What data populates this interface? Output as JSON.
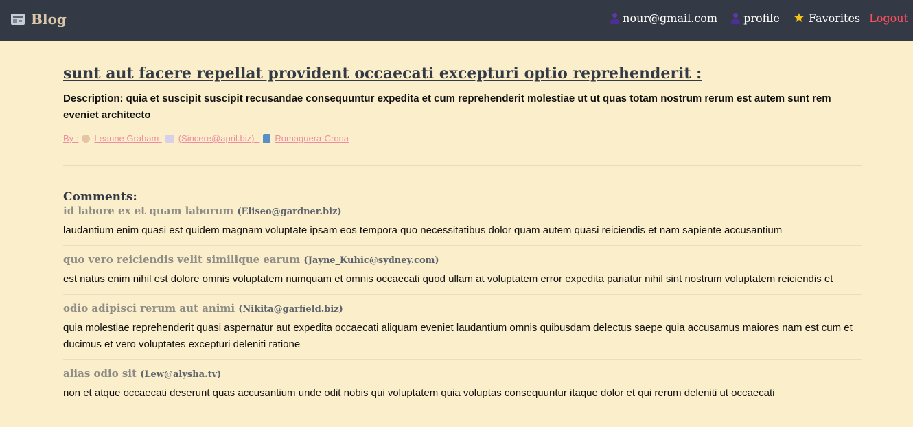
{
  "navbar": {
    "brand": "Blog",
    "user_email": "nour@gmail.com",
    "profile_label": "profile",
    "favorites_label": "Favorites",
    "logout_label": "Logout"
  },
  "post": {
    "title": "sunt aut facere repellat provident occaecati excepturi optio reprehenderit :",
    "description": "Description: quia et suscipit suscipit recusandae consequuntur expedita et cum reprehenderit molestiae ut ut quas totam nostrum rerum est autem sunt rem eveniet architecto",
    "byline": {
      "prefix": "By :",
      "author": "Leanne Graham-",
      "email": "(Sincere@april.biz) -",
      "company": "Romaguera-Crona"
    }
  },
  "comments_heading": "Comments:",
  "comments": [
    {
      "name": "id labore ex et quam laborum",
      "email": "(Eliseo@gardner.biz)",
      "body": "laudantium enim quasi est quidem magnam voluptate ipsam eos tempora quo necessitatibus dolor quam autem quasi reiciendis et nam sapiente accusantium"
    },
    {
      "name": "quo vero reiciendis velit similique earum",
      "email": "(Jayne_Kuhic@sydney.com)",
      "body": "est natus enim nihil est dolore omnis voluptatem numquam et omnis occaecati quod ullam at voluptatem error expedita pariatur nihil sint nostrum voluptatem reiciendis et"
    },
    {
      "name": "odio adipisci rerum aut animi",
      "email": "(Nikita@garfield.biz)",
      "body": "quia molestiae reprehenderit quasi aspernatur aut expedita occaecati aliquam eveniet laudantium omnis quibusdam delectus saepe quia accusamus maiores nam est cum et ducimus et vero voluptates excepturi deleniti ratione"
    },
    {
      "name": "alias odio sit",
      "email": "(Lew@alysha.tv)",
      "body": "non et atque occaecati deserunt quas accusantium unde odit nobis qui voluptatem quia voluptas consequuntur itaque dolor et qui rerum deleniti ut occaecati"
    }
  ],
  "colors": {
    "navbar_bg": "#343a45",
    "page_bg": "#fbeecb",
    "logout": "#ff4d5e",
    "byline": "#f08ca0"
  }
}
